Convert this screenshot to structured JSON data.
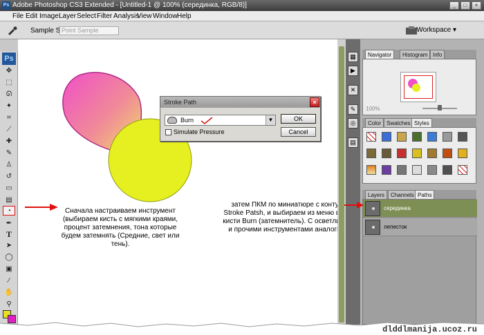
{
  "window": {
    "title": "Adobe Photoshop CS3 Extended - [Untitled-1 @ 100% (серединка, RGB/8)]",
    "app_icon": "photoshop-icon"
  },
  "menu": [
    "File",
    "Edit",
    "Image",
    "Layer",
    "Select",
    "Filter",
    "Analysis",
    "View",
    "Window",
    "Help"
  ],
  "options_bar": {
    "sample_size_label": "Sample Size:",
    "sample_size_value": "Point Sample",
    "workspace_label": "Workspace ▾"
  },
  "toolbox": {
    "logo": "Ps",
    "tools": [
      "move",
      "marquee",
      "lasso",
      "magic-wand",
      "crop",
      "slice",
      "healing",
      "brush",
      "stamp",
      "history-brush",
      "eraser",
      "gradient",
      "burn",
      "pen",
      "type",
      "path-select",
      "shape",
      "notes",
      "eyedropper",
      "hand",
      "zoom"
    ]
  },
  "navigator_panel": {
    "tabs": [
      "Navigator",
      "Histogram",
      "Info"
    ],
    "zoom": "100%"
  },
  "swatches_panel": {
    "tabs": [
      "Color",
      "Swatches",
      "Styles"
    ]
  },
  "paths_panel": {
    "tabs": [
      "Layers",
      "Channels",
      "Paths"
    ],
    "paths": [
      "серединка",
      "лепесток"
    ]
  },
  "dialog": {
    "title": "Stroke Path",
    "tool_value": "Burn",
    "simulate_label": "Simulate Pressure",
    "ok_label": "OK",
    "cancel_label": "Cancel"
  },
  "annotations": {
    "left": "Сначала настраиваем инструмент (выбираем кисть с мягкими краями, процент затемнения, тона которые будем затемнять (Средние, свет или тень).",
    "right": "затем ПКМ по миниатюре с контуром Stroke Patsh, и выбираем из меню вместо кисти Burn (затемнитель). С осветлителем и прочими инструментами аналогично!"
  },
  "watermark": "dlddlmanija.ucoz.ru",
  "colors": {
    "petal_top": "#f050c8",
    "petal_bottom": "#f3e067",
    "center": "#e6ef1f",
    "arrow": "#e01010",
    "path_selected": "#7e8f55"
  }
}
